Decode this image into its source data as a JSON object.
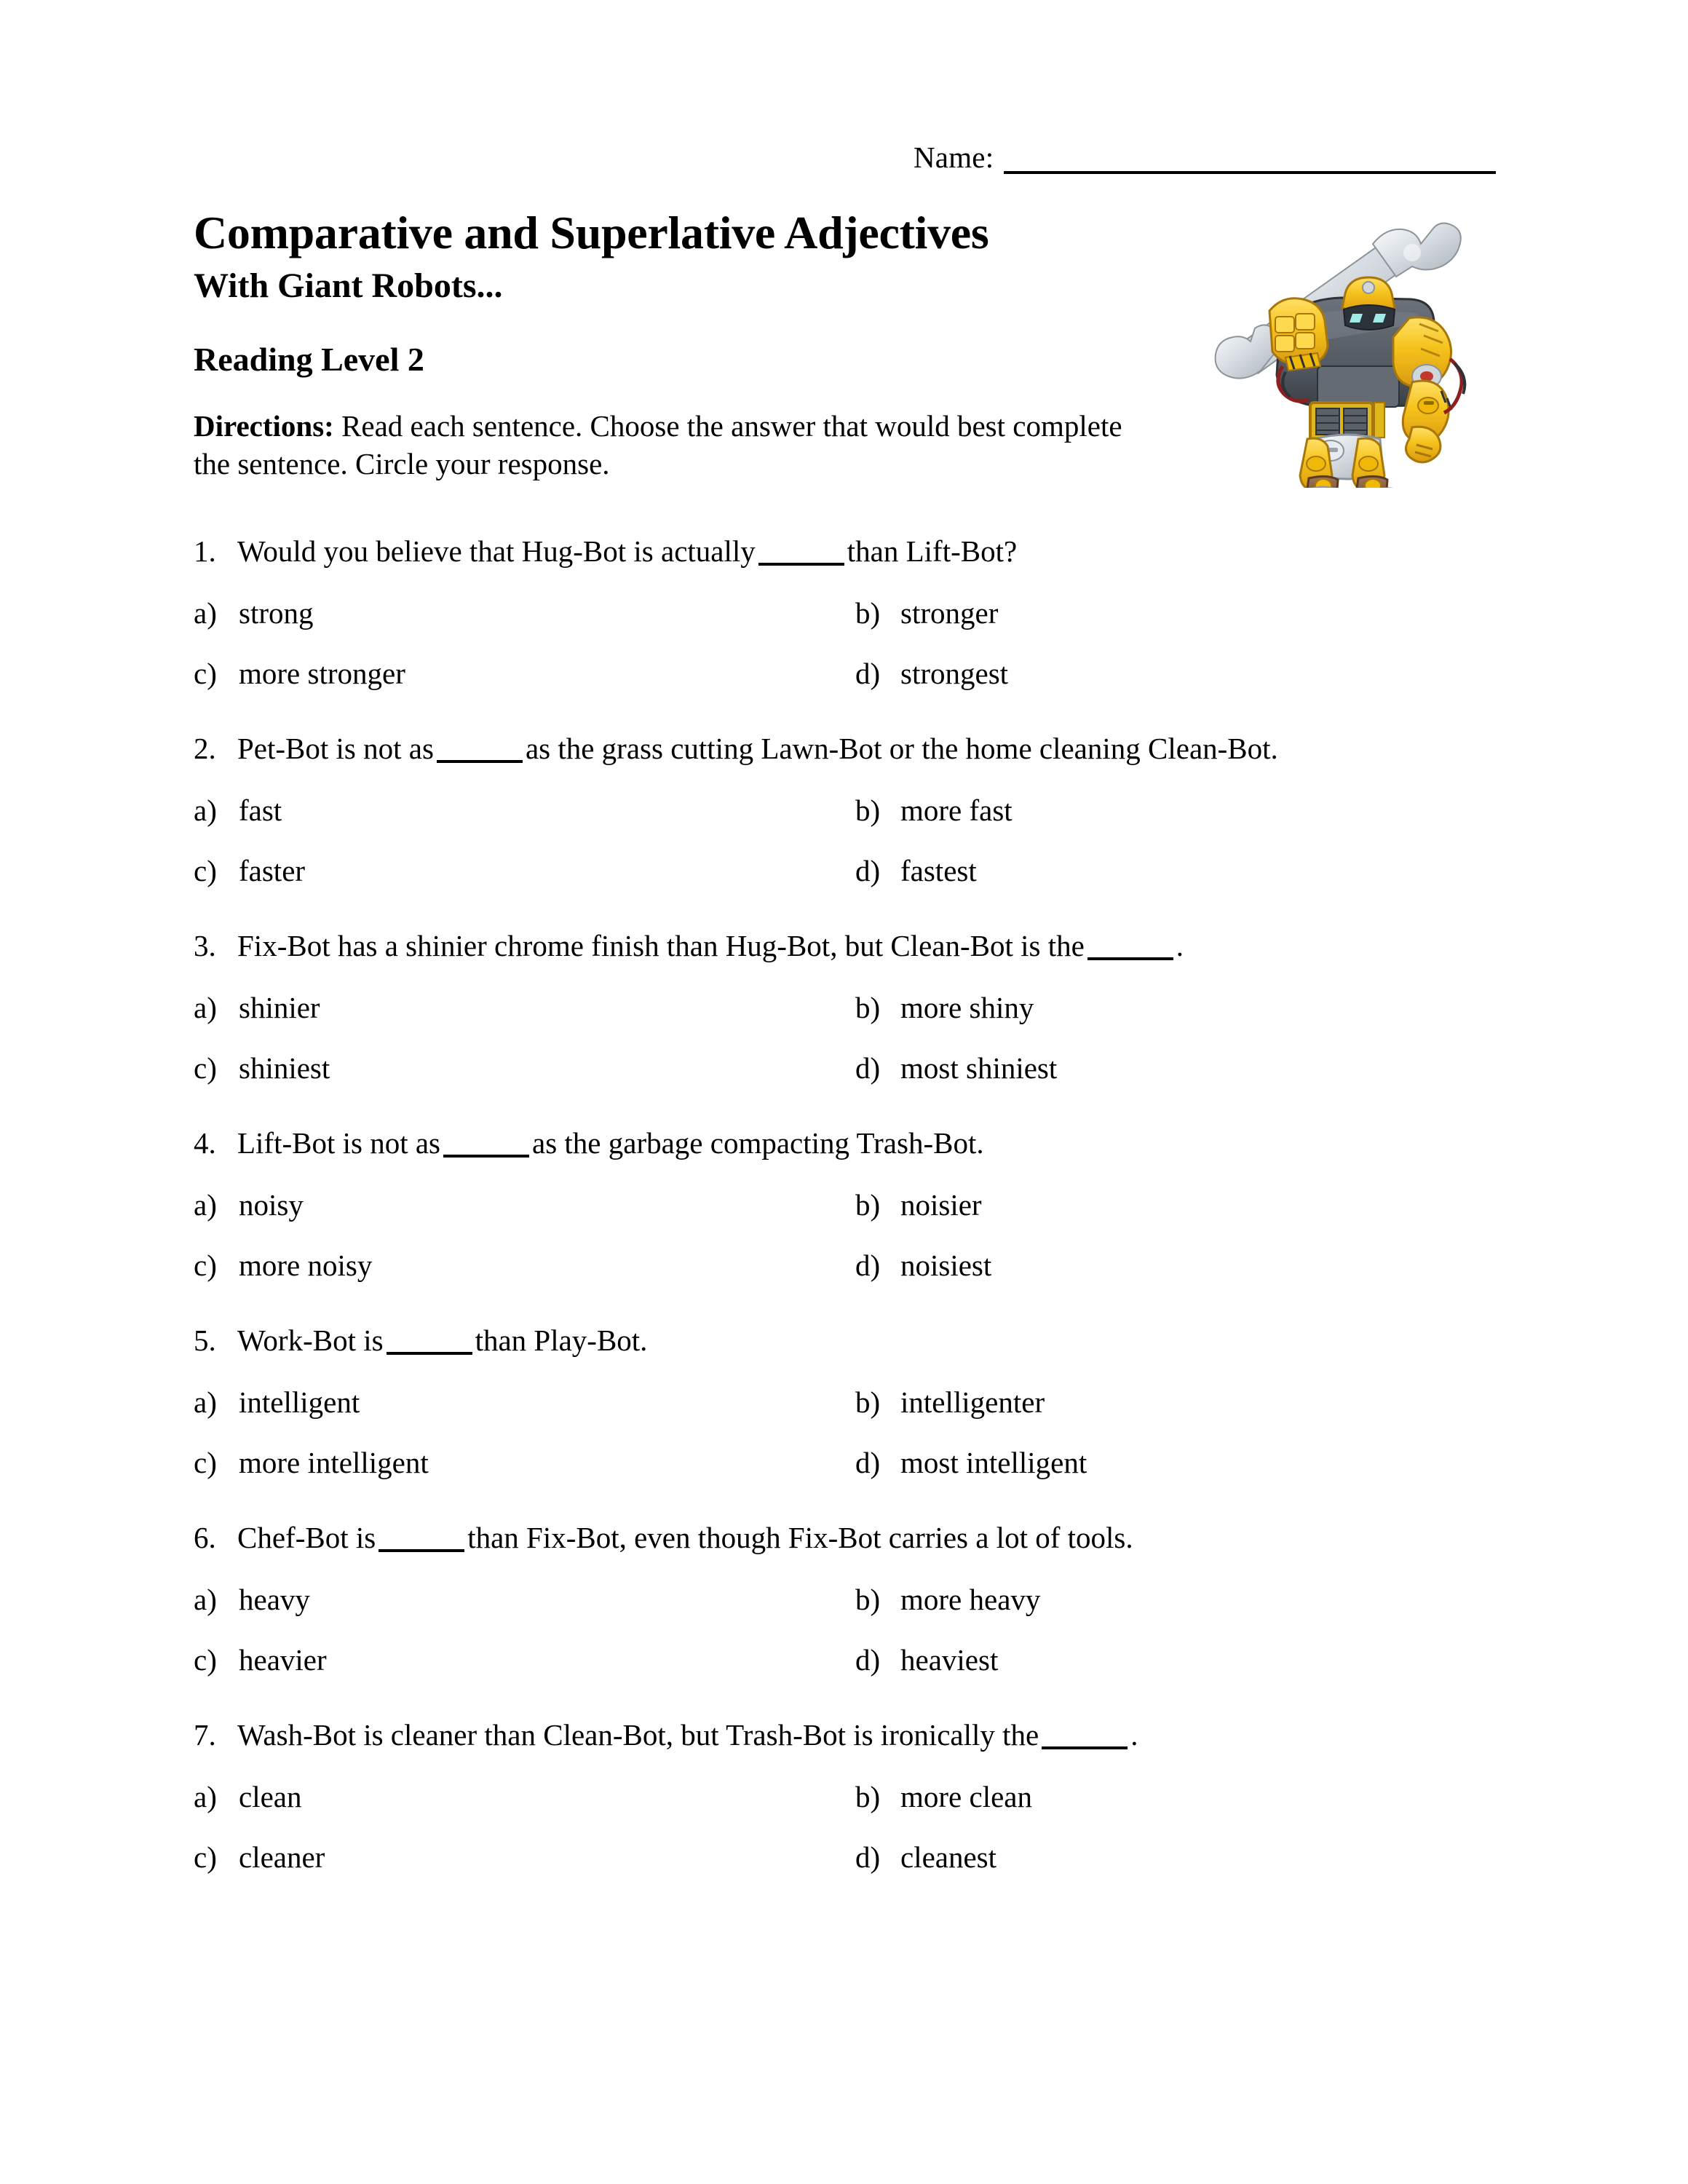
{
  "header": {
    "name_label": "Name:",
    "name_value": ""
  },
  "title": {
    "main": "Comparative and Superlative Adjectives",
    "subtitle": "With Giant Robots...",
    "reading_level": "Reading Level 2"
  },
  "directions": {
    "label": "Directions:",
    "text": " Read each sentence. Choose the answer that would best complete the sentence. Circle your response."
  },
  "illustration": {
    "name": "giant-robot-with-wrench",
    "colors": {
      "body_yellow": "#f5c21b",
      "body_yellow_dark": "#d99a10",
      "torso_gray": "#5b6168",
      "torso_gray_dark": "#3e444b",
      "metal_silver": "#d8dde2",
      "metal_silver_dark": "#a8b0b8",
      "boot_brown": "#8c6044",
      "boot_dark": "#2b2b2b",
      "eye_cyan": "#9fe9e6",
      "accent_red": "#c0392b"
    }
  },
  "questions": [
    {
      "number": "1.",
      "text_before": "Would you believe that Hug-Bot is actually",
      "text_after": "than Lift-Bot?",
      "options": [
        {
          "label": "a)",
          "text": "strong"
        },
        {
          "label": "b)",
          "text": "stronger"
        },
        {
          "label": "c)",
          "text": "more stronger"
        },
        {
          "label": "d)",
          "text": "strongest"
        }
      ]
    },
    {
      "number": "2.",
      "text_before": "Pet-Bot is not as",
      "text_after": "as the grass cutting Lawn-Bot or the home cleaning Clean-Bot.",
      "options": [
        {
          "label": "a)",
          "text": "fast"
        },
        {
          "label": "b)",
          "text": "more fast"
        },
        {
          "label": "c)",
          "text": "faster"
        },
        {
          "label": "d)",
          "text": "fastest"
        }
      ]
    },
    {
      "number": "3.",
      "text_before": "Fix-Bot has a shinier chrome finish than Hug-Bot, but Clean-Bot is the",
      "text_after": ".",
      "options": [
        {
          "label": "a)",
          "text": "shinier"
        },
        {
          "label": "b)",
          "text": "more shiny"
        },
        {
          "label": "c)",
          "text": "shiniest"
        },
        {
          "label": "d)",
          "text": "most shiniest"
        }
      ]
    },
    {
      "number": "4.",
      "text_before": "Lift-Bot is not as",
      "text_after": "as the garbage compacting Trash-Bot.",
      "options": [
        {
          "label": "a)",
          "text": "noisy"
        },
        {
          "label": "b)",
          "text": "noisier"
        },
        {
          "label": "c)",
          "text": "more noisy"
        },
        {
          "label": "d)",
          "text": "noisiest"
        }
      ]
    },
    {
      "number": "5.",
      "text_before": "Work-Bot is",
      "text_after": "than Play-Bot.",
      "options": [
        {
          "label": "a)",
          "text": "intelligent"
        },
        {
          "label": "b)",
          "text": "intelligenter"
        },
        {
          "label": "c)",
          "text": "more intelligent"
        },
        {
          "label": "d)",
          "text": "most intelligent"
        }
      ]
    },
    {
      "number": "6.",
      "text_before": "Chef-Bot is",
      "text_after": "than Fix-Bot, even though Fix-Bot carries a lot of tools.",
      "options": [
        {
          "label": "a)",
          "text": "heavy"
        },
        {
          "label": "b)",
          "text": "more heavy"
        },
        {
          "label": "c)",
          "text": "heavier"
        },
        {
          "label": "d)",
          "text": "heaviest"
        }
      ]
    },
    {
      "number": "7.",
      "text_before": "Wash-Bot is cleaner than Clean-Bot, but Trash-Bot is ironically the",
      "text_after": ".",
      "options": [
        {
          "label": "a)",
          "text": "clean"
        },
        {
          "label": "b)",
          "text": "more clean"
        },
        {
          "label": "c)",
          "text": "cleaner"
        },
        {
          "label": "d)",
          "text": "cleanest"
        }
      ]
    }
  ]
}
